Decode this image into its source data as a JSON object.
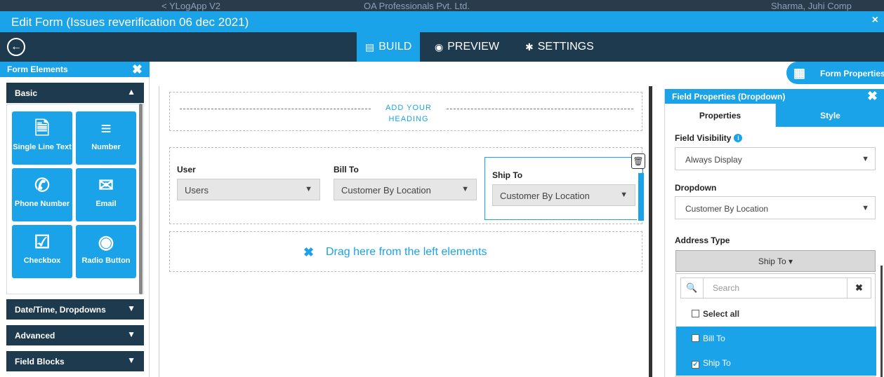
{
  "background": {
    "left_text": "< YLogApp V2",
    "center_text": "OA Professionals Pvt. Ltd.",
    "right_text": "Sharma, Juhi Comp"
  },
  "window": {
    "title": "Edit Form (Issues reverification 06 dec 2021)",
    "close_label": "×"
  },
  "nav": {
    "back_icon": "←",
    "tabs": [
      {
        "label": "BUILD",
        "icon": "▤",
        "active": true
      },
      {
        "label": "PREVIEW",
        "icon": "◉",
        "active": false
      },
      {
        "label": "SETTINGS",
        "icon": "✱",
        "active": false
      }
    ]
  },
  "left_panel": {
    "title": "Form Elements",
    "close_label": "✖",
    "sections": [
      {
        "label": "Basic",
        "expanded": true,
        "chev": "▲"
      },
      {
        "label": "Date/Time, Dropdowns",
        "expanded": false,
        "chev": "▼"
      },
      {
        "label": "Advanced",
        "expanded": false,
        "chev": "▼"
      },
      {
        "label": "Field Blocks",
        "expanded": false,
        "chev": "▼"
      }
    ],
    "elements": [
      {
        "label": "Single Line Text",
        "icon": "🗎",
        "icon_name": "document-icon"
      },
      {
        "label": "Number",
        "icon": "≡",
        "icon_name": "numbered-list-icon"
      },
      {
        "label": "Phone Number",
        "icon": "✆",
        "icon_name": "phone-icon"
      },
      {
        "label": "Email",
        "icon": "✉",
        "icon_name": "envelope-icon"
      },
      {
        "label": "Checkbox",
        "icon": "☑",
        "icon_name": "checkbox-icon"
      },
      {
        "label": "Radio Button",
        "icon": "◉",
        "icon_name": "radio-icon"
      }
    ]
  },
  "form_properties": {
    "label": "Form Properties",
    "icon": "▦"
  },
  "canvas": {
    "heading_placeholder": "ADD YOUR HEADING",
    "fields": [
      {
        "label": "User",
        "value": "Users"
      },
      {
        "label": "Bill To",
        "value": "Customer By Location"
      },
      {
        "label": "Ship To",
        "value": "Customer By Location"
      }
    ],
    "drop_hint": "Drag here from the left elements",
    "drop_icon": "✖",
    "trash_icon": "🗑"
  },
  "right_panel": {
    "title": "Field Properties (Dropdown)",
    "close_label": "✖",
    "tabs": [
      {
        "label": "Properties",
        "active": true
      },
      {
        "label": "Style",
        "active": false
      }
    ],
    "field_visibility": {
      "label": "Field Visibility",
      "info": "i",
      "value": "Always Display"
    },
    "dropdown": {
      "label": "Dropdown",
      "value": "Customer By Location"
    },
    "address_type": {
      "label": "Address Type",
      "button_label": "Ship To ▾",
      "search_placeholder": "Search",
      "search_icon": "🔍",
      "clear_icon": "✖",
      "select_all_label": "Select all",
      "options": [
        {
          "label": "Bill To",
          "checked": false
        },
        {
          "label": "Ship To",
          "checked": true
        }
      ]
    }
  },
  "colors": {
    "accent": "#1aa3e8",
    "navy": "#1d3a4e"
  }
}
